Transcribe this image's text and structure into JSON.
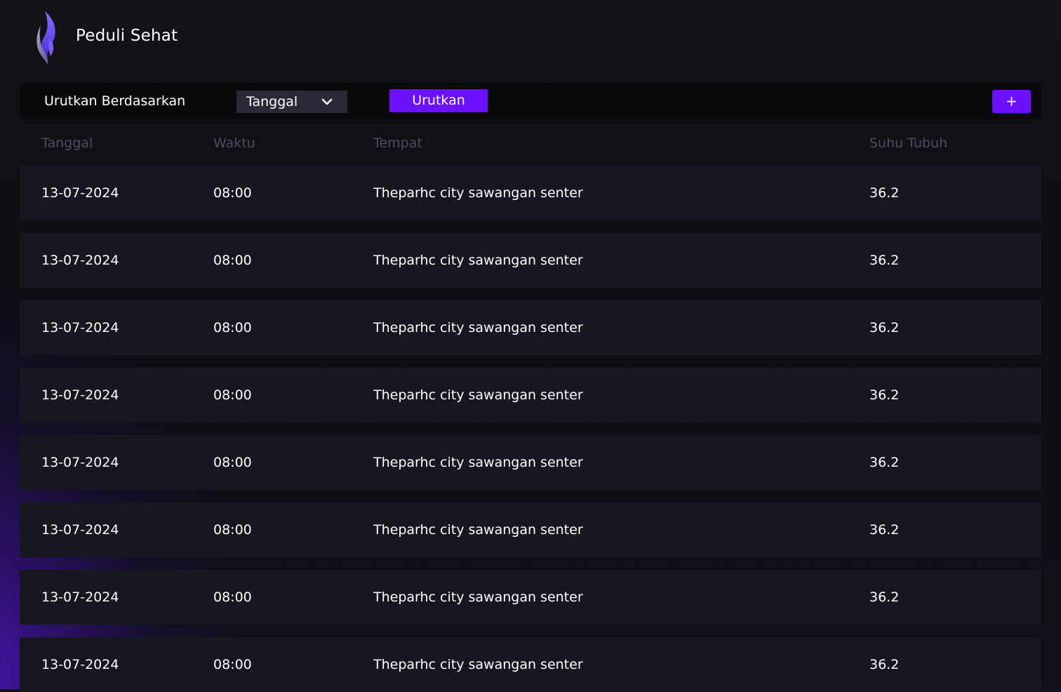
{
  "app": {
    "title": "Peduli Sehat"
  },
  "toolbar": {
    "sort_label": "Urutkan Berdasarkan",
    "sort_select_value": "Tanggal",
    "sort_button_label": "Urutkan",
    "add_button_label": "+"
  },
  "table": {
    "columns": [
      "Tanggal",
      "Waktu",
      "Tempat",
      "Suhu Tubuh"
    ],
    "rows": [
      [
        "13-07-2024",
        "08:00",
        "Theparhc city sawangan senter",
        "36.2"
      ],
      [
        "13-07-2024",
        "08:00",
        "Theparhc city sawangan senter",
        "36.2"
      ],
      [
        "13-07-2024",
        "08:00",
        "Theparhc city sawangan senter",
        "36.2"
      ],
      [
        "13-07-2024",
        "08:00",
        "Theparhc city sawangan senter",
        "36.2"
      ],
      [
        "13-07-2024",
        "08:00",
        "Theparhc city sawangan senter",
        "36.2"
      ],
      [
        "13-07-2024",
        "08:00",
        "Theparhc city sawangan senter",
        "36.2"
      ],
      [
        "13-07-2024",
        "08:00",
        "Theparhc city sawangan senter",
        "36.2"
      ],
      [
        "13-07-2024",
        "08:00",
        "Theparhc city sawangan senter",
        "36.2"
      ]
    ]
  },
  "icons": {
    "logo": "flame-logo-icon",
    "dropdown": "chevron-down-icon"
  },
  "colors": {
    "accent": "#6a10ff",
    "background": "#111117",
    "row_background": "#17171f",
    "header_text": "#4e4e58"
  }
}
